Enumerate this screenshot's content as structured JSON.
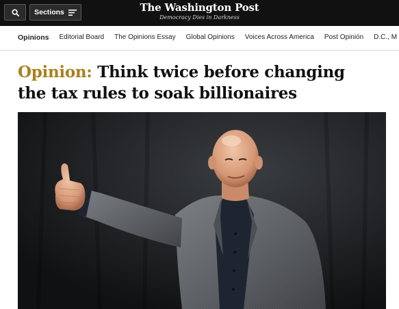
{
  "header": {
    "search_icon": "search-icon",
    "sections_label": "Sections",
    "menu_icon": "menu-icon",
    "brand_name": "The Washington Post",
    "brand_tagline": "Democracy Dies in Darkness",
    "background_color": "#111111"
  },
  "nav": {
    "items": [
      {
        "label": "Opinions",
        "active": true
      },
      {
        "label": "Editorial Board"
      },
      {
        "label": "The Opinions Essay"
      },
      {
        "label": "Global Opinions"
      },
      {
        "label": "Voices Across America"
      },
      {
        "label": "Post Opinión"
      },
      {
        "label": "D.C., M"
      }
    ]
  },
  "article": {
    "kicker": "Opinion:",
    "kicker_color": "#a9801e",
    "title": "Think twice before changing the tax rules to soak billionaires"
  },
  "photo": {
    "subject": "bald man in a gray tweed blazer and dark shirt giving a thumbs up"
  }
}
